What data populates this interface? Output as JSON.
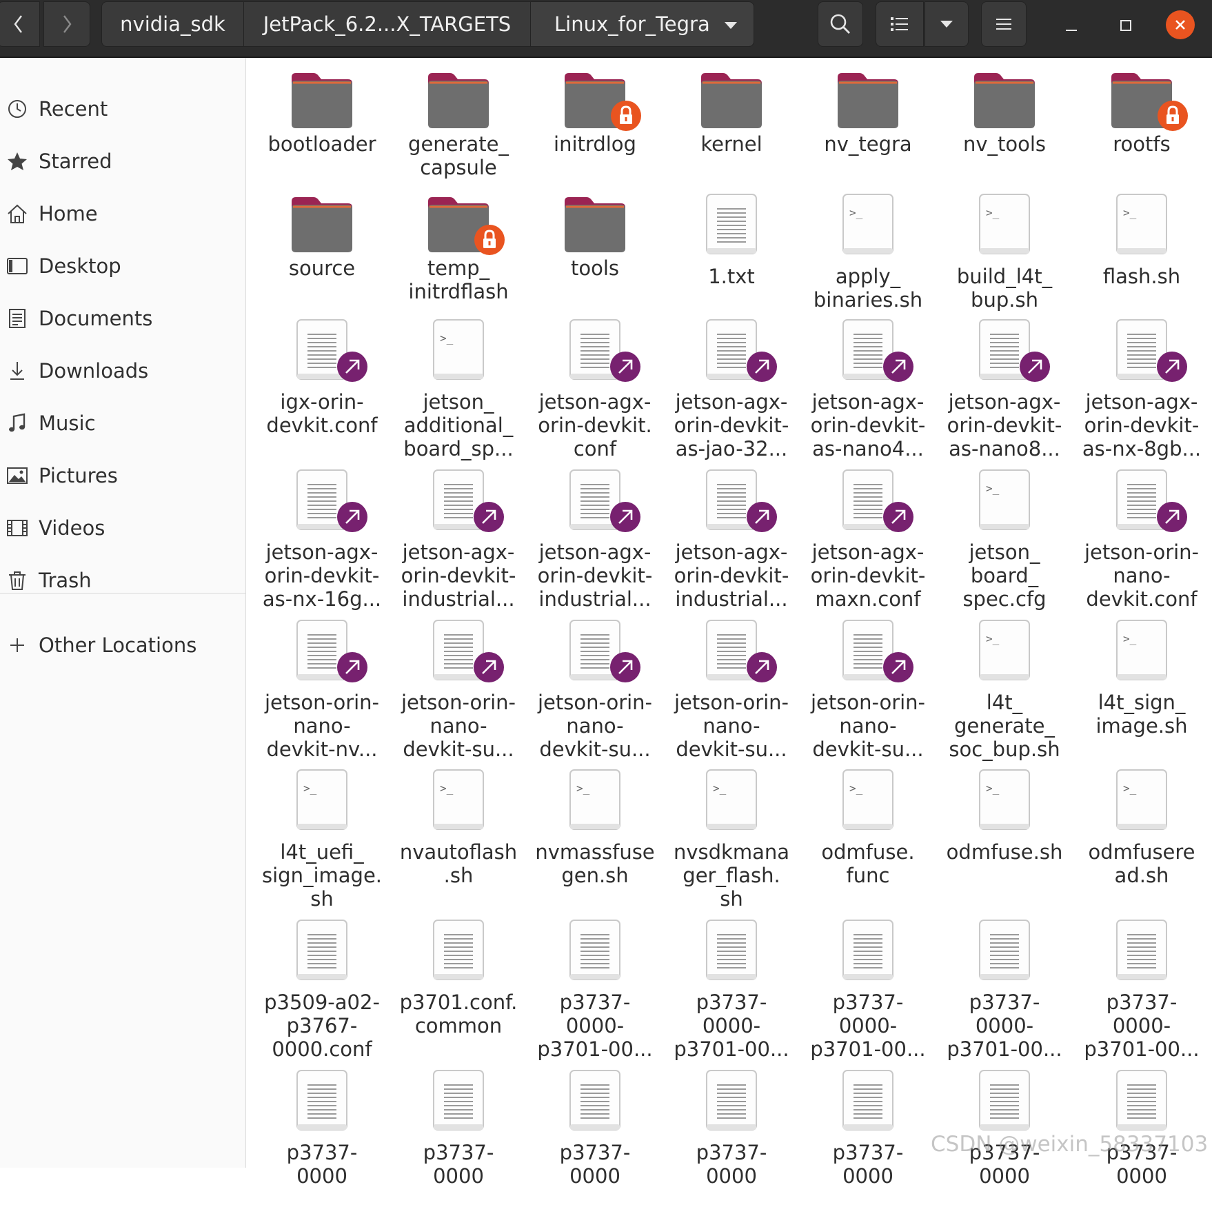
{
  "header": {
    "breadcrumbs": [
      "nvidia_sdk",
      "JetPack_6.2...X_TARGETS",
      "Linux_for_Tegra"
    ],
    "icons": [
      "back-icon",
      "forward-icon",
      "dropdown-icon",
      "search-icon",
      "list-view-icon",
      "view-options-icon",
      "menu-icon",
      "minimize-icon",
      "maximize-icon",
      "close-icon"
    ]
  },
  "sidebar": {
    "items": [
      {
        "label": "Recent",
        "icon": "clock-icon"
      },
      {
        "label": "Starred",
        "icon": "star-icon"
      },
      {
        "label": "Home",
        "icon": "home-icon"
      },
      {
        "label": "Desktop",
        "icon": "desktop-icon"
      },
      {
        "label": "Documents",
        "icon": "documents-icon"
      },
      {
        "label": "Downloads",
        "icon": "downloads-icon"
      },
      {
        "label": "Music",
        "icon": "music-icon"
      },
      {
        "label": "Pictures",
        "icon": "pictures-icon"
      },
      {
        "label": "Videos",
        "icon": "videos-icon"
      },
      {
        "label": "Trash",
        "icon": "trash-icon"
      }
    ],
    "other_locations": {
      "label": "Other Locations",
      "icon": "plus-icon"
    }
  },
  "files": [
    {
      "name": "bootloader",
      "type": "folder"
    },
    {
      "name": "generate_\ncapsule",
      "type": "folder"
    },
    {
      "name": "initrdlog",
      "type": "folder-locked"
    },
    {
      "name": "kernel",
      "type": "folder"
    },
    {
      "name": "nv_tegra",
      "type": "folder"
    },
    {
      "name": "nv_tools",
      "type": "folder"
    },
    {
      "name": "rootfs",
      "type": "folder-locked"
    },
    {
      "name": "source",
      "type": "folder"
    },
    {
      "name": "temp_\ninitrdflash",
      "type": "folder-locked"
    },
    {
      "name": "tools",
      "type": "folder"
    },
    {
      "name": "1.txt",
      "type": "text"
    },
    {
      "name": "apply_\nbinaries.sh",
      "type": "script"
    },
    {
      "name": "build_l4t_\nbup.sh",
      "type": "script"
    },
    {
      "name": "flash.sh",
      "type": "script"
    },
    {
      "name": "igx-orin-\ndevkit.conf",
      "type": "link"
    },
    {
      "name": "jetson_\nadditional_\nboard_sp...",
      "type": "script"
    },
    {
      "name": "jetson-agx-\norin-devkit.\nconf",
      "type": "link"
    },
    {
      "name": "jetson-agx-\norin-devkit-\nas-jao-32...",
      "type": "link"
    },
    {
      "name": "jetson-agx-\norin-devkit-\nas-nano4...",
      "type": "link"
    },
    {
      "name": "jetson-agx-\norin-devkit-\nas-nano8...",
      "type": "link"
    },
    {
      "name": "jetson-agx-\norin-devkit-\nas-nx-8gb...",
      "type": "link"
    },
    {
      "name": "jetson-agx-\norin-devkit-\nas-nx-16g...",
      "type": "link"
    },
    {
      "name": "jetson-agx-\norin-devkit-\nindustrial...",
      "type": "link"
    },
    {
      "name": "jetson-agx-\norin-devkit-\nindustrial...",
      "type": "link"
    },
    {
      "name": "jetson-agx-\norin-devkit-\nindustrial...",
      "type": "link"
    },
    {
      "name": "jetson-agx-\norin-devkit-\nmaxn.conf",
      "type": "link"
    },
    {
      "name": "jetson_\nboard_\nspec.cfg",
      "type": "script"
    },
    {
      "name": "jetson-orin-\nnano-\ndevkit.conf",
      "type": "link"
    },
    {
      "name": "jetson-orin-\nnano-\ndevkit-nv...",
      "type": "link"
    },
    {
      "name": "jetson-orin-\nnano-\ndevkit-su...",
      "type": "link"
    },
    {
      "name": "jetson-orin-\nnano-\ndevkit-su...",
      "type": "link"
    },
    {
      "name": "jetson-orin-\nnano-\ndevkit-su...",
      "type": "link"
    },
    {
      "name": "jetson-orin-\nnano-\ndevkit-su...",
      "type": "link"
    },
    {
      "name": "l4t_\ngenerate_\nsoc_bup.sh",
      "type": "script"
    },
    {
      "name": "l4t_sign_\nimage.sh",
      "type": "script"
    },
    {
      "name": "l4t_uefi_\nsign_image.\nsh",
      "type": "script"
    },
    {
      "name": "nvautoflash\n.sh",
      "type": "script"
    },
    {
      "name": "nvmassfuse\ngen.sh",
      "type": "script"
    },
    {
      "name": "nvsdkmana\nger_flash.\nsh",
      "type": "script"
    },
    {
      "name": "odmfuse.\nfunc",
      "type": "script"
    },
    {
      "name": "odmfuse.sh",
      "type": "script"
    },
    {
      "name": "odmfusere\nad.sh",
      "type": "script"
    },
    {
      "name": "p3509-a02-\np3767-\n0000.conf",
      "type": "text"
    },
    {
      "name": "p3701.conf.\ncommon",
      "type": "text"
    },
    {
      "name": "p3737-\n0000-\np3701-00...",
      "type": "text"
    },
    {
      "name": "p3737-\n0000-\np3701-00...",
      "type": "text"
    },
    {
      "name": "p3737-\n0000-\np3701-00...",
      "type": "text"
    },
    {
      "name": "p3737-\n0000-\np3701-00...",
      "type": "text"
    },
    {
      "name": "p3737-\n0000-\np3701-00...",
      "type": "text"
    },
    {
      "name": "p3737-\n0000",
      "type": "text"
    },
    {
      "name": "p3737-\n0000",
      "type": "text"
    },
    {
      "name": "p3737-\n0000",
      "type": "text"
    },
    {
      "name": "p3737-\n0000",
      "type": "text"
    },
    {
      "name": "p3737-\n0000",
      "type": "text"
    },
    {
      "name": "p3737-\n0000",
      "type": "text"
    },
    {
      "name": "p3737-\n0000",
      "type": "text"
    }
  ],
  "watermark": "CSDN @weixin_58337103",
  "colors": {
    "accent": "#e95420",
    "link_badge": "#77216f",
    "folder_top": "#9b2453",
    "folder_body": "#6e6e6e"
  }
}
